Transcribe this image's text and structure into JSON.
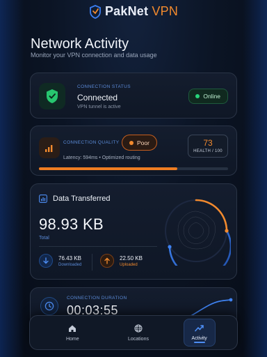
{
  "app": {
    "brand_part1": "PakNet",
    "brand_part2": "VPN"
  },
  "page": {
    "title": "Network Activity",
    "subtitle": "Monitor your VPN connection and data usage"
  },
  "status_card": {
    "label": "CONNECTION STATUS",
    "value": "Connected",
    "detail": "VPN tunnel is active",
    "badge": "Online",
    "badge_color": "#27d37a"
  },
  "quality_card": {
    "label": "CONNECTION QUALITY",
    "badge": "Poor",
    "badge_color": "#f28a2e",
    "latency": "Latency: 594ms • Optimized routing",
    "health_score": "73",
    "health_label": "HEALTH / 100",
    "progress": 0.73
  },
  "data_card": {
    "title": "Data Transferred",
    "total_value": "98.93 KB",
    "total_label": "Total",
    "download_value": "76.43 KB",
    "download_label": "Downloaded",
    "upload_value": "22.50 KB",
    "upload_label": "Uploaded"
  },
  "duration_card": {
    "label": "CONNECTION DURATION",
    "value": "00:03:55"
  },
  "nav": {
    "items": [
      {
        "label": "Home",
        "icon": "home-icon"
      },
      {
        "label": "Locations",
        "icon": "globe-icon"
      },
      {
        "label": "Activity",
        "icon": "activity-icon"
      }
    ],
    "active": "Activity"
  },
  "colors": {
    "accent_blue": "#4d8df3",
    "accent_orange": "#f28a2e",
    "success": "#27d37a"
  }
}
